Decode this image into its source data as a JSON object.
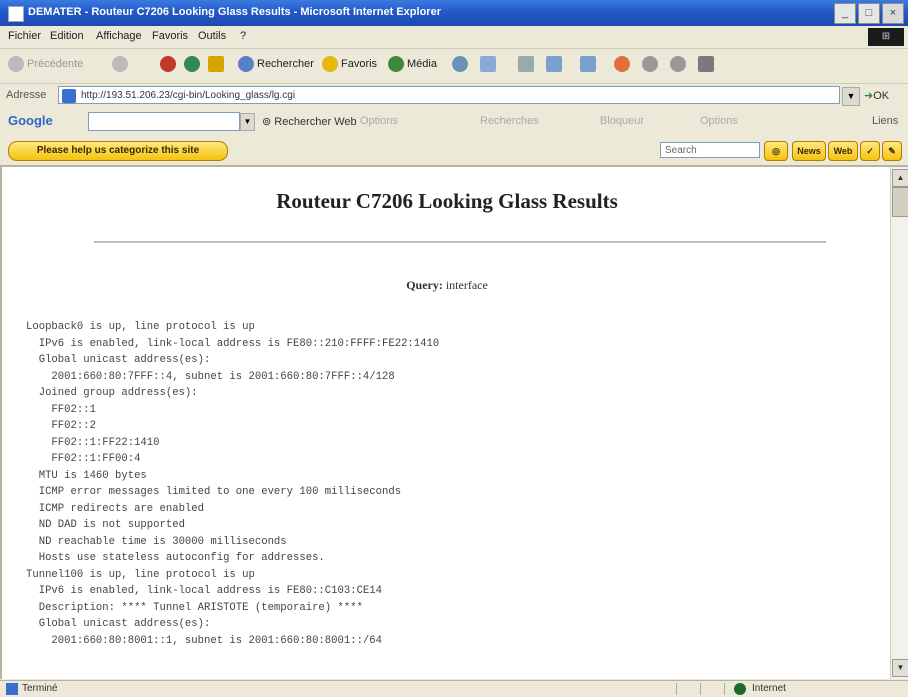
{
  "window": {
    "title": "DEMATER - Routeur C7206 Looking Glass Results - Microsoft Internet Explorer",
    "buttons": [
      "_",
      "□",
      "×"
    ]
  },
  "menu": [
    "Fichier",
    "Edition",
    "Affichage",
    "Favoris",
    "Outils",
    "?"
  ],
  "toolbar": {
    "back": "Précédente",
    "search": "Rechercher",
    "favorites": "Favoris",
    "media": "Média"
  },
  "address": {
    "label": "Adresse",
    "url": "http://193.51.206.23/cgi-bin/Looking_glass/lg.cgi",
    "go": "OK"
  },
  "google": {
    "logo": "Google",
    "search_web": "Rechercher Web",
    "faded": [
      "Options",
      "Recherches",
      "Bloqueur",
      "Options"
    ],
    "liens": "Liens"
  },
  "helpbar": {
    "button": "Please help us categorize this site",
    "search_placeholder": "Search",
    "btn_news": "News",
    "btn_web": "Web"
  },
  "page": {
    "title": "Routeur C7206 Looking Glass Results",
    "query_label": "Query:",
    "query_value": "interface",
    "output": "Loopback0 is up, line protocol is up\n  IPv6 is enabled, link-local address is FE80::210:FFFF:FE22:1410\n  Global unicast address(es):\n    2001:660:80:7FFF::4, subnet is 2001:660:80:7FFF::4/128\n  Joined group address(es):\n    FF02::1\n    FF02::2\n    FF02::1:FF22:1410\n    FF02::1:FF00:4\n  MTU is 1460 bytes\n  ICMP error messages limited to one every 100 milliseconds\n  ICMP redirects are enabled\n  ND DAD is not supported\n  ND reachable time is 30000 milliseconds\n  Hosts use stateless autoconfig for addresses.\nTunnel100 is up, line protocol is up\n  IPv6 is enabled, link-local address is FE80::C103:CE14\n  Description: **** Tunnel ARISTOTE (temporaire) ****\n  Global unicast address(es):\n    2001:660:80:8001::1, subnet is 2001:660:80:8001::/64"
  },
  "status": {
    "left": "Terminé",
    "zone": "Internet"
  }
}
